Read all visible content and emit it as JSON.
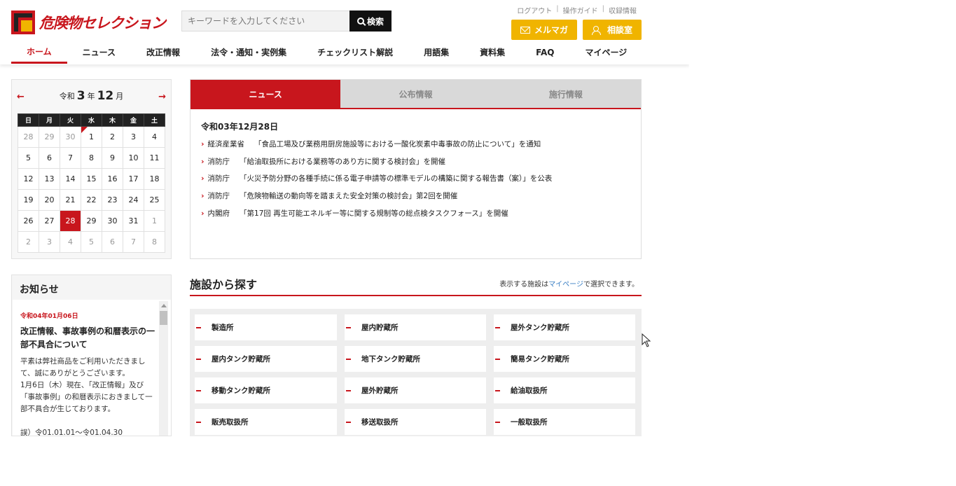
{
  "logo": {
    "text": "危険物セレクション"
  },
  "search": {
    "placeholder": "キーワードを入力してください",
    "button_label": "検索"
  },
  "util_links": [
    "ログアウト",
    "操作ガイド",
    "収録情報"
  ],
  "buttons": {
    "mail": "メルマガ",
    "consult": "相談室"
  },
  "nav": [
    "ホーム",
    "ニュース",
    "改正情報",
    "法令・通知・実例集",
    "チェックリスト解説",
    "用語集",
    "資料集",
    "FAQ",
    "マイページ"
  ],
  "calendar": {
    "era": "令和",
    "year": "3",
    "year_suffix": "年",
    "month": "12",
    "month_suffix": "月",
    "weekdays": [
      "日",
      "月",
      "火",
      "水",
      "木",
      "金",
      "土"
    ],
    "weeks": [
      [
        "28",
        "29",
        "30",
        "1",
        "2",
        "3",
        "4"
      ],
      [
        "5",
        "6",
        "7",
        "8",
        "9",
        "10",
        "11"
      ],
      [
        "12",
        "13",
        "14",
        "15",
        "16",
        "17",
        "18"
      ],
      [
        "19",
        "20",
        "21",
        "22",
        "23",
        "24",
        "25"
      ],
      [
        "26",
        "27",
        "28",
        "29",
        "30",
        "31",
        "1"
      ],
      [
        "2",
        "3",
        "4",
        "5",
        "6",
        "7",
        "8"
      ]
    ],
    "today": "28",
    "accent": "#c8161d"
  },
  "notice": {
    "title": "お知らせ",
    "date": "令和04年01月06日",
    "heading": "改正情報、事故事例の和暦表示の一部不具合について",
    "body": [
      "平素は弊社商品をご利用いただきまして、誠にありがとうございます。",
      "1月6日（木）現在、「改正情報」及び「事故事例」の和暦表示におきまして一部不具合が生じております。",
      "",
      "誤）令01.01.01～令01.04.30"
    ]
  },
  "tabs": [
    "ニュース",
    "公布情報",
    "施行情報"
  ],
  "news": {
    "date": "令和03年12月28日",
    "items": [
      {
        "source": "経済産業省",
        "text": "「食品工場及び業務用厨房施設等における一酸化炭素中毒事故の防止について」を通知"
      },
      {
        "source": "消防庁",
        "text": "「給油取扱所における業務等のあり方に関する検討会」を開催"
      },
      {
        "source": "消防庁",
        "text": "「火災予防分野の各種手続に係る電子申請等の標準モデルの構築に関する報告書（案）」を公表"
      },
      {
        "source": "消防庁",
        "text": "「危険物輸送の動向等を踏まえた安全対策の検討会」第2回を開催"
      },
      {
        "source": "内閣府",
        "text": "「第17回 再生可能エネルギー等に関する規制等の総点検タスクフォース」を開催"
      }
    ]
  },
  "facility": {
    "title": "施設から探す",
    "note_before": "表示する施設は",
    "note_link": "マイページ",
    "note_after": "で選択できます。",
    "items": [
      "製造所",
      "屋内貯蔵所",
      "屋外タンク貯蔵所",
      "屋内タンク貯蔵所",
      "地下タンク貯蔵所",
      "簡易タンク貯蔵所",
      "移動タンク貯蔵所",
      "屋外貯蔵所",
      "給油取扱所",
      "販売取扱所",
      "移送取扱所",
      "一般取扱所"
    ]
  }
}
